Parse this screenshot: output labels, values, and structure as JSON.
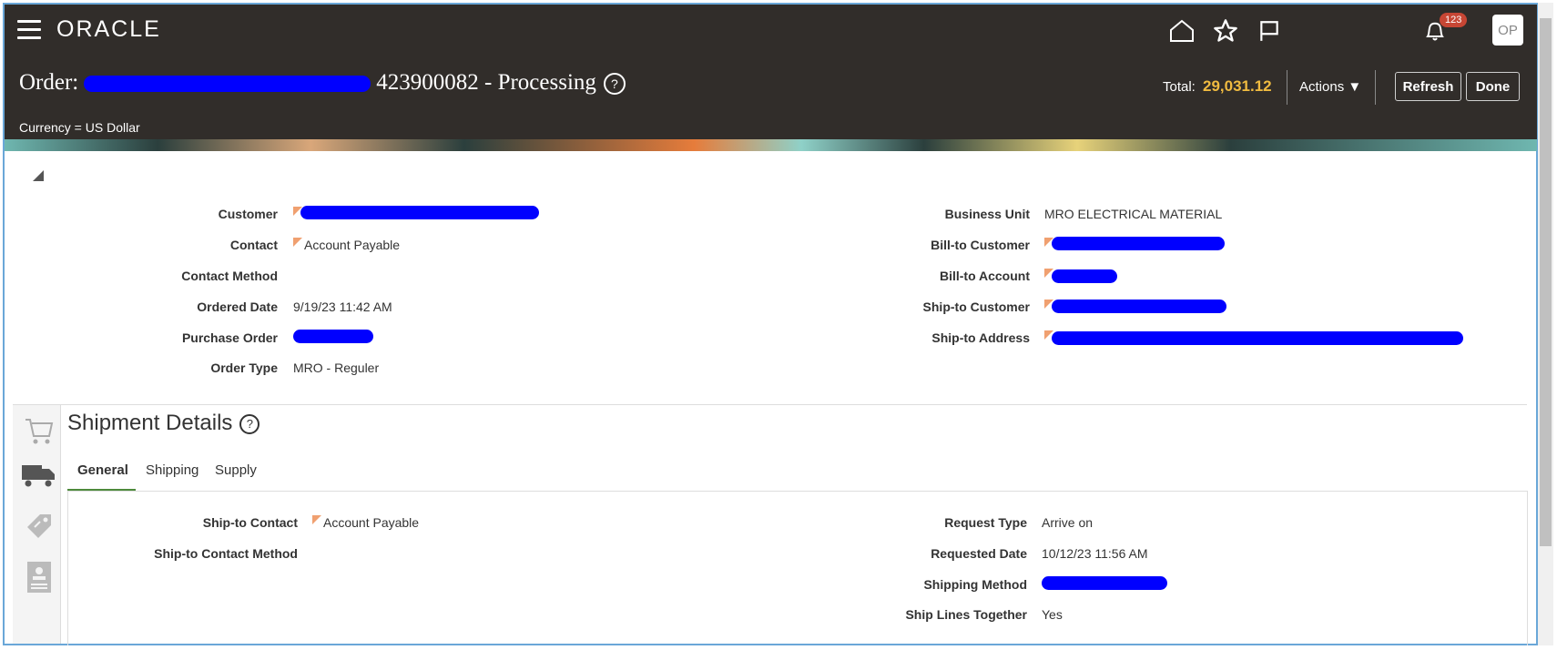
{
  "header": {
    "logo": "ORACLE",
    "notification_count": "123",
    "avatar": "OP",
    "title_prefix": "Order:",
    "title_suffix": "423900082 - Processing",
    "help": "?",
    "currency": "Currency = US Dollar",
    "total_label": "Total:",
    "total_value": "29,031.12",
    "actions_label": "Actions",
    "refresh_label": "Refresh",
    "done_label": "Done"
  },
  "order_fields": {
    "customer_label": "Customer",
    "contact_label": "Contact",
    "contact_value": "Account Payable",
    "contact_method_label": "Contact Method",
    "ordered_date_label": "Ordered Date",
    "ordered_date_value": "9/19/23 11:42 AM",
    "purchase_order_label": "Purchase Order",
    "order_type_label": "Order Type",
    "order_type_value": "MRO - Reguler",
    "business_unit_label": "Business Unit",
    "business_unit_value": "MRO ELECTRICAL MATERIAL",
    "bill_to_customer_label": "Bill-to Customer",
    "bill_to_account_label": "Bill-to Account",
    "ship_to_customer_label": "Ship-to Customer",
    "ship_to_address_label": "Ship-to Address"
  },
  "shipment": {
    "title": "Shipment Details",
    "tabs": [
      "General",
      "Shipping",
      "Supply"
    ],
    "ship_to_contact_label": "Ship-to Contact",
    "ship_to_contact_value": "Account Payable",
    "ship_to_contact_method_label": "Ship-to Contact Method",
    "request_type_label": "Request Type",
    "request_type_value": "Arrive on",
    "requested_date_label": "Requested Date",
    "requested_date_value": "10/12/23 11:56 AM",
    "shipping_method_label": "Shipping Method",
    "ship_lines_together_label": "Ship Lines Together",
    "ship_lines_together_value": "Yes"
  },
  "colors": {
    "header_bg": "#312d2a",
    "total_accent": "#f0bb40",
    "tab_active": "#4d8a3c",
    "redaction": "#0000ff"
  }
}
